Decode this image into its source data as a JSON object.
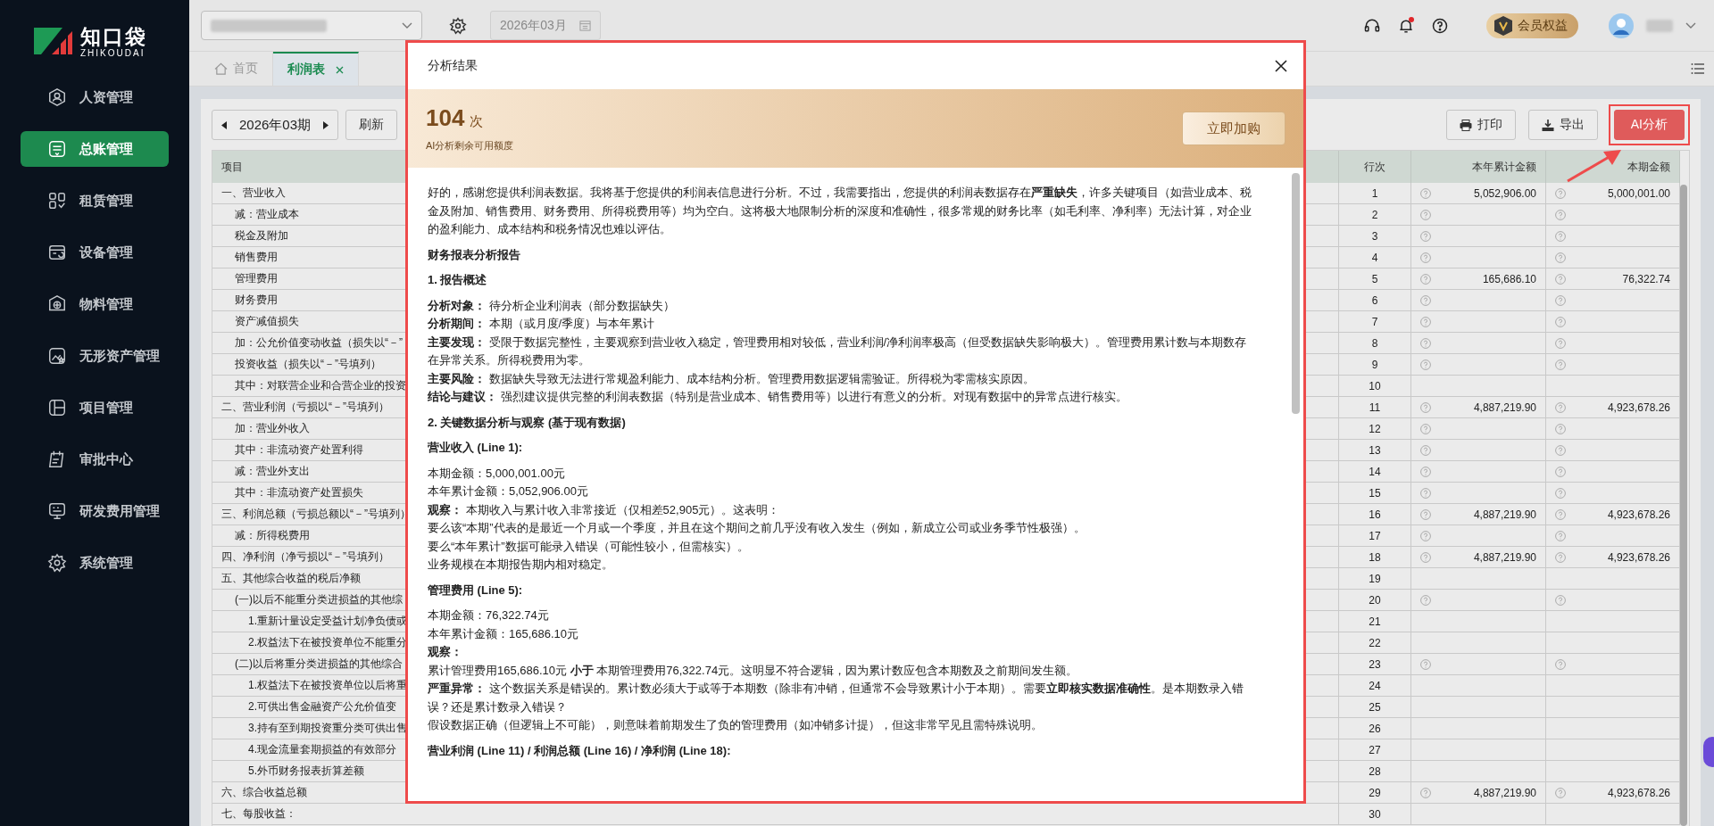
{
  "sidebar": {
    "logo": {
      "name": "知口袋",
      "subtitle": "ZHIKOUDAI"
    },
    "items": [
      {
        "label": "人资管理",
        "selected": false
      },
      {
        "label": "总账管理",
        "selected": true
      },
      {
        "label": "租赁管理",
        "selected": false
      },
      {
        "label": "设备管理",
        "selected": false
      },
      {
        "label": "物料管理",
        "selected": false
      },
      {
        "label": "无形资产管理",
        "selected": false
      },
      {
        "label": "项目管理",
        "selected": false
      },
      {
        "label": "审批中心",
        "selected": false
      },
      {
        "label": "研发费用管理",
        "selected": false
      },
      {
        "label": "系统管理",
        "selected": false
      }
    ]
  },
  "topbar": {
    "date": "2026年03月",
    "vip": "会员权益",
    "notification": true
  },
  "tabs": [
    {
      "label": "首页",
      "selected": false,
      "closable": false
    },
    {
      "label": "利润表",
      "selected": true,
      "closable": true
    }
  ],
  "toolbar": {
    "period": "2026年03期",
    "refresh": "刷新",
    "print": "打印",
    "export": "导出",
    "ai": "AI分析"
  },
  "table": {
    "columns": [
      "项目",
      "行次",
      "本年累计金额",
      "本期金额"
    ],
    "rows": [
      {
        "item": "一、营业收入",
        "line": "1",
        "ytd": "5,052,906.00",
        "current": "5,000,001.00",
        "hint": true,
        "children": [
          {
            "item": "减：营业成本",
            "line": "2",
            "hint": true
          },
          {
            "item": "税金及附加",
            "line": "3",
            "hint": true
          },
          {
            "item": "销售费用",
            "line": "4",
            "hint": true
          },
          {
            "item": "管理费用",
            "line": "5",
            "ytd": "165,686.10",
            "current": "76,322.74",
            "hint": true
          },
          {
            "item": "财务费用",
            "line": "6",
            "hint": true
          },
          {
            "item": "资产减值损失",
            "line": "7",
            "hint": true
          },
          {
            "item": "加：公允价值变动收益（损失以“－”",
            "line": "8",
            "hint": true
          },
          {
            "item": "投资收益（损失以“－”号填列）",
            "line": "9",
            "hint": true
          },
          {
            "item": "其中：对联营企业和合营企业的投资",
            "line": "10",
            "hint": false
          }
        ]
      },
      {
        "item": "二、营业利润（亏损以“－”号填列）",
        "line": "11",
        "ytd": "4,887,219.90",
        "current": "4,923,678.26",
        "hint": true,
        "children": [
          {
            "item": "加：营业外收入",
            "line": "12",
            "hint": true
          },
          {
            "item": "其中：非流动资产处置利得",
            "line": "13",
            "hint": true
          },
          {
            "item": "减：营业外支出",
            "line": "14",
            "hint": true
          },
          {
            "item": "其中：非流动资产处置损失",
            "line": "15",
            "hint": true
          }
        ]
      },
      {
        "item": "三、利润总额（亏损总额以“－”号填列）",
        "line": "16",
        "ytd": "4,887,219.90",
        "current": "4,923,678.26",
        "hint": true,
        "children": [
          {
            "item": "减：所得税费用",
            "line": "17",
            "hint": true
          }
        ]
      },
      {
        "item": "四、净利润（净亏损以“－”号填列）",
        "line": "18",
        "ytd": "4,887,219.90",
        "current": "4,923,678.26",
        "hint": true
      },
      {
        "item": "五、其他综合收益的税后净额",
        "line": "19",
        "hint": false,
        "children": [
          {
            "item": "(一)以后不能重分类进损益的其他综",
            "line": "20",
            "hint": true,
            "children": [
              {
                "item": "1.重新计量设定受益计划净负债或",
                "line": "21",
                "hint": false
              },
              {
                "item": "2.权益法下在被投资单位不能重分",
                "line": "22",
                "hint": false
              }
            ]
          },
          {
            "item": "(二)以后将重分类进损益的其他综合",
            "line": "23",
            "hint": true,
            "children": [
              {
                "item": "1.权益法下在被投资单位以后将重",
                "line": "24",
                "hint": false
              },
              {
                "item": "2.可供出售金融资产公允价值变",
                "line": "25",
                "hint": false
              },
              {
                "item": "3.持有至到期投资重分类可供出售",
                "line": "26",
                "hint": false
              },
              {
                "item": "4.现金流量套期损益的有效部分",
                "line": "27",
                "hint": false
              },
              {
                "item": "5.外币财务报表折算差额",
                "line": "28",
                "hint": false
              }
            ]
          }
        ]
      },
      {
        "item": "六、综合收益总额",
        "line": "29",
        "ytd": "4,887,219.90",
        "current": "4,923,678.26",
        "hint": true
      },
      {
        "item": "七、每股收益：",
        "line": "30",
        "hint": false
      }
    ]
  },
  "modal": {
    "title": "分析结果",
    "count": "104",
    "unit": "次",
    "quota_label": "AI分析剩余可用额度",
    "buy": "立即加购",
    "blocks": [
      {
        "kind": "para",
        "text": "好的，感谢您提供利润表数据。我将基于您提供的利润表信息进行分析。不过，我需要指出，您提供的利润表数据存在**严重缺失**，许多关键项目（如营业成本、税金及附加、销售费用、财务费用、所得税费用等）均为空白。这将极大地限制分析的深度和准确性，很多常规的财务比率（如毛利率、净利率）无法计算，对企业的盈利能力、成本结构和税务情况也难以评估。"
      },
      {
        "kind": "heading",
        "text": "财务报表分析报告"
      },
      {
        "kind": "heading",
        "text": "1. 报告概述"
      },
      {
        "kind": "line",
        "text": "**分析对象：** 待分析企业利润表（部分数据缺失）"
      },
      {
        "kind": "line",
        "text": "**分析期间：** 本期（或月度/季度）与本年累计"
      },
      {
        "kind": "line",
        "text": "**主要发现：** 受限于数据完整性，主要观察到营业收入稳定，管理费用相对较低，营业利润/净利润率极高（但受数据缺失影响极大）。管理费用累计数与本期数存在异常关系。所得税费用为零。"
      },
      {
        "kind": "line",
        "text": "**主要风险：** 数据缺失导致无法进行常规盈利能力、成本结构分析。管理费用数据逻辑需验证。所得税为零需核实原因。"
      },
      {
        "kind": "line",
        "text": "**结论与建议：** 强烈建议提供完整的利润表数据（特别是营业成本、销售费用等）以进行有意义的分析。对现有数据中的异常点进行核实。"
      },
      {
        "kind": "heading",
        "text": "2. 关键数据分析与观察 (基于现有数据)"
      },
      {
        "kind": "heading",
        "text": "营业收入 (Line 1):"
      },
      {
        "kind": "line",
        "text": "本期金额：5,000,001.00元"
      },
      {
        "kind": "line",
        "text": "本年累计金额：5,052,906.00元"
      },
      {
        "kind": "line",
        "text": "**观察：** 本期收入与累计收入非常接近（仅相差52,905元）。这表明："
      },
      {
        "kind": "line",
        "text": "要么该“本期”代表的是最近一个月或一个季度，并且在这个期间之前几乎没有收入发生（例如，新成立公司或业务季节性极强）。"
      },
      {
        "kind": "line",
        "text": "要么“本年累计”数据可能录入错误（可能性较小，但需核实）。"
      },
      {
        "kind": "line",
        "text": "业务规模在本期报告期内相对稳定。"
      },
      {
        "kind": "heading",
        "text": "管理费用 (Line 5):"
      },
      {
        "kind": "line",
        "text": "本期金额：76,322.74元"
      },
      {
        "kind": "line",
        "text": "本年累计金额：165,686.10元"
      },
      {
        "kind": "line",
        "text": "**观察：**"
      },
      {
        "kind": "line",
        "text": "累计管理费用165,686.10元 **小于** 本期管理费用76,322.74元。这明显不符合逻辑，因为累计数应包含本期数及之前期间发生额。"
      },
      {
        "kind": "line",
        "text": "**严重异常：** 这个数据关系是错误的。累计数必须大于或等于本期数（除非有冲销，但通常不会导致累计小于本期）。需要**立即核实数据准确性**。是本期数录入错误？还是累计数录入错误？"
      },
      {
        "kind": "line",
        "text": "假设数据正确（但逻辑上不可能），则意味着前期发生了负的管理费用（如冲销多计提），但这非常罕见且需特殊说明。"
      },
      {
        "kind": "heading",
        "text": "营业利润 (Line 11) / 利润总额 (Line 16) / 净利润 (Line 18):"
      }
    ]
  }
}
